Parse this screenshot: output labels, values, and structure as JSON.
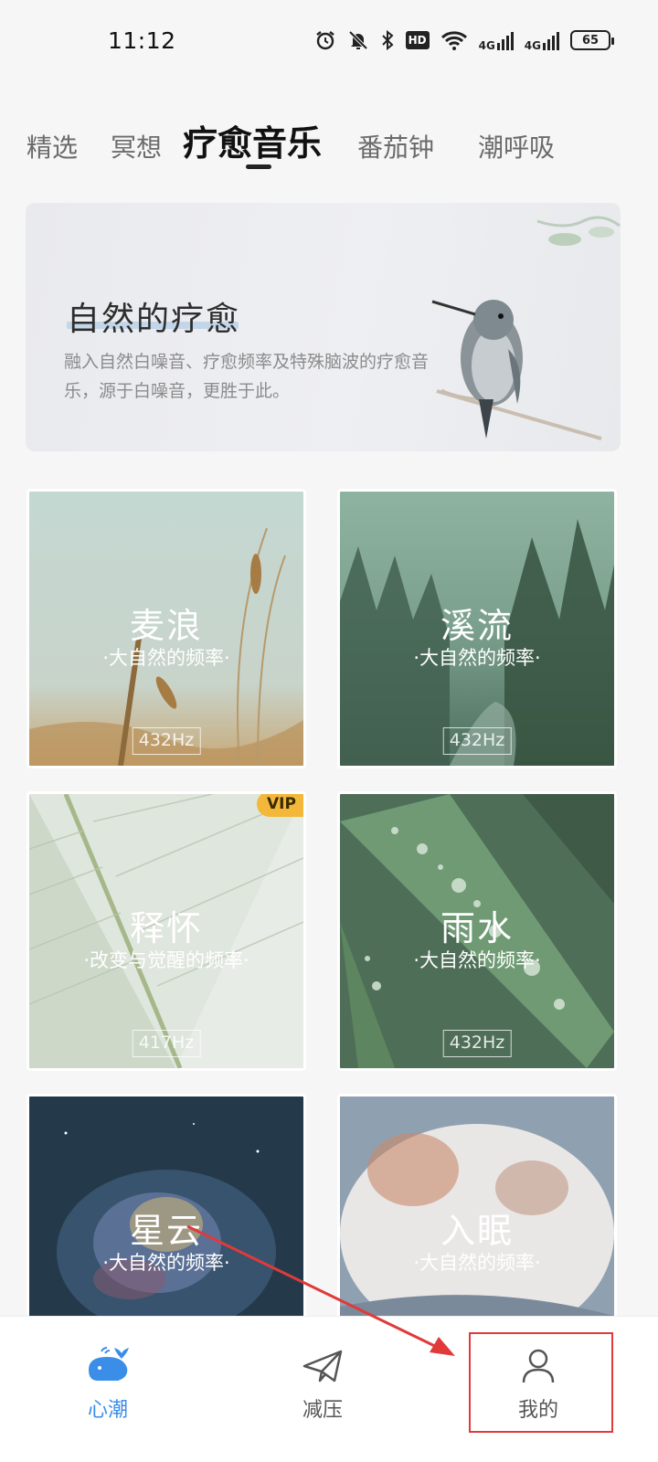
{
  "status_bar": {
    "time": "11:12",
    "hd_label": "HD",
    "net1": "4G",
    "net2": "4G",
    "battery": "65"
  },
  "tabs": [
    {
      "label": "精选",
      "active": false
    },
    {
      "label": "冥想",
      "active": false
    },
    {
      "label": "疗愈音乐",
      "active": true
    },
    {
      "label": "番茄钟",
      "active": false
    },
    {
      "label": "潮呼吸",
      "active": false
    }
  ],
  "banner": {
    "title": "自然的疗愈",
    "description": "融入自然白噪音、疗愈频率及特殊脑波的疗愈音乐，源于白噪音，更胜于此。"
  },
  "cards": [
    {
      "title": "麦浪",
      "subtitle": "·大自然的频率·",
      "freq": "432Hz"
    },
    {
      "title": "溪流",
      "subtitle": "·大自然的频率·",
      "freq": "432Hz"
    },
    {
      "title": "释怀",
      "subtitle": "·改变与觉醒的频率·",
      "freq": "417Hz",
      "badge": "VIP"
    },
    {
      "title": "雨水",
      "subtitle": "·大自然的频率·",
      "freq": "432Hz"
    },
    {
      "title": "星云",
      "subtitle": "·大自然的频率·"
    },
    {
      "title": "入眠",
      "subtitle": "·大自然的频率·"
    }
  ],
  "bottom_nav": [
    {
      "label": "心潮",
      "icon": "whale-icon",
      "active": true
    },
    {
      "label": "减压",
      "icon": "paper-plane-icon",
      "active": false
    },
    {
      "label": "我的",
      "icon": "user-icon",
      "active": false
    }
  ],
  "colors": {
    "accent": "#3a8ee8",
    "vip": "#f3b73a",
    "annotation": "#e03a3a"
  }
}
